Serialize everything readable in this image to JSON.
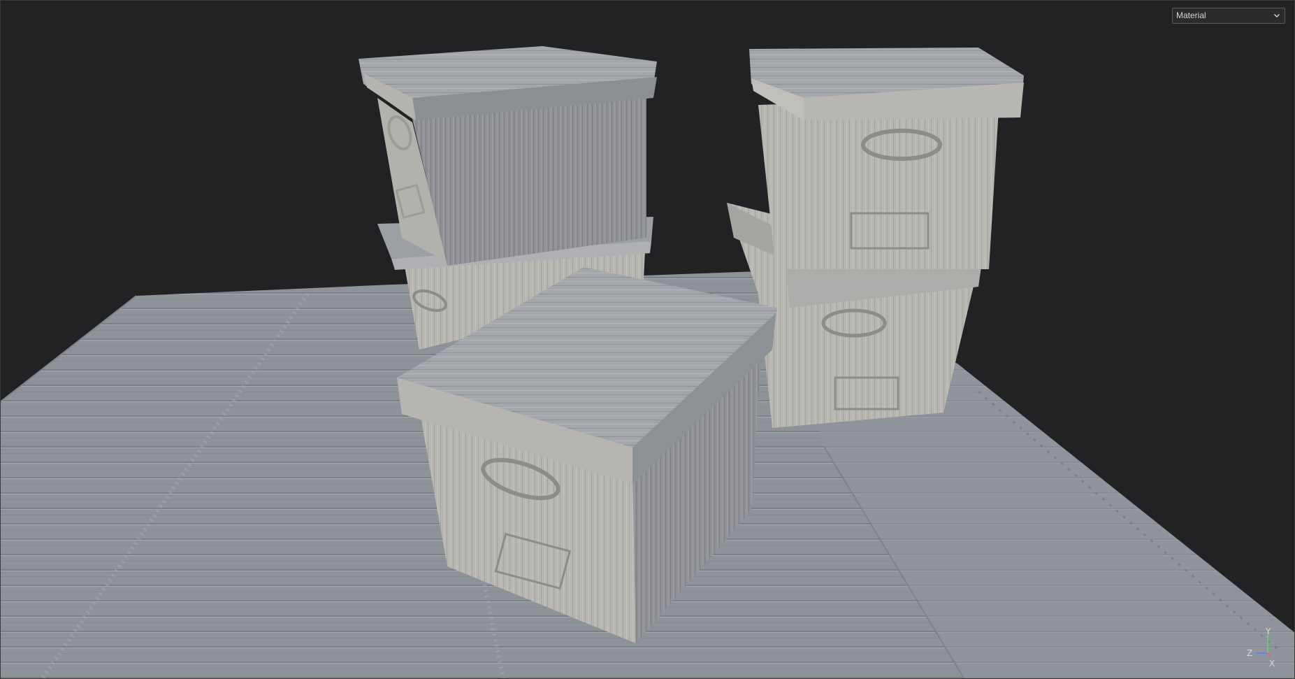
{
  "viewport": {
    "shading_mode": "Material",
    "background": "#222224"
  },
  "axis_gizmo": {
    "y_label": "Y",
    "z_label": "Z",
    "x_label": "X",
    "colors": {
      "y": "#6fd26f",
      "z": "#5a7cff",
      "x": "#ff5a5a"
    }
  },
  "icons": {
    "dropdown": "chevron-down-icon"
  }
}
